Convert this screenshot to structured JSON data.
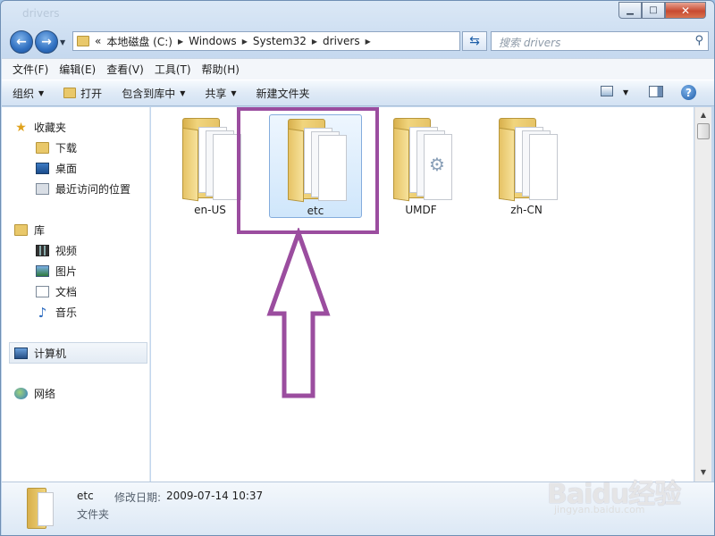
{
  "window": {
    "title": "drivers"
  },
  "address": {
    "overflow_marker": "«",
    "segments": [
      "本地磁盘 (C:)",
      "Windows",
      "System32",
      "drivers"
    ]
  },
  "search": {
    "placeholder": "搜索 drivers"
  },
  "menu": [
    "文件(F)",
    "编辑(E)",
    "查看(V)",
    "工具(T)",
    "帮助(H)"
  ],
  "toolbar": {
    "organize": "组织",
    "open": "打开",
    "include_library": "包含到库中",
    "share": "共享",
    "new_folder": "新建文件夹"
  },
  "nav": {
    "favorites": "收藏夹",
    "downloads": "下载",
    "desktop": "桌面",
    "recent": "最近访问的位置",
    "libraries": "库",
    "videos": "视频",
    "pictures": "图片",
    "documents": "文档",
    "music": "音乐",
    "computer": "计算机",
    "network": "网络"
  },
  "files": [
    {
      "name": "en-US",
      "selected": false
    },
    {
      "name": "etc",
      "selected": true
    },
    {
      "name": "UMDF",
      "selected": false
    },
    {
      "name": "zh-CN",
      "selected": false
    }
  ],
  "details": {
    "name": "etc",
    "modified_label": "修改日期:",
    "modified_value": "2009-07-14 10:37",
    "type": "文件夹"
  },
  "watermark": {
    "logo": "Baidu经验",
    "url": "jingyan.baidu.com"
  },
  "colors": {
    "annotation": "#9b4d9f",
    "selection": "#cfe6fb",
    "folder": "#e9c86a"
  }
}
